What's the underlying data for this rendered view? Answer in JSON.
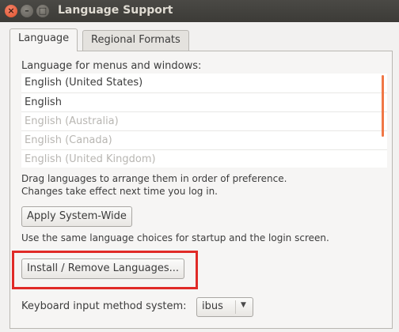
{
  "window": {
    "title": "Language Support",
    "close_glyph": "×",
    "min_glyph": "–",
    "max_glyph": "□"
  },
  "tabs": [
    {
      "label": "Language",
      "active": true
    },
    {
      "label": "Regional Formats",
      "active": false
    }
  ],
  "language": {
    "list_heading": "Language for menus and windows:",
    "items": [
      {
        "label": "English (United States)",
        "enabled": true
      },
      {
        "label": "English",
        "enabled": true
      },
      {
        "label": "English (Australia)",
        "enabled": false
      },
      {
        "label": "English (Canada)",
        "enabled": false
      },
      {
        "label": "English (United Kingdom)",
        "enabled": false
      }
    ],
    "help_line1": "Drag languages to arrange them in order of preference.",
    "help_line2": "Changes take effect next time you log in.",
    "apply_button": "Apply System-Wide",
    "apply_help": "Use the same language choices for startup and the login screen.",
    "install_button": "Install / Remove Languages...",
    "keyboard_label": "Keyboard input method system:",
    "keyboard_value": "ibus",
    "dropdown_glyph": "▼"
  },
  "colors": {
    "highlight": "#e02a27",
    "scroll_accent": "#f07746",
    "titlebar": "#3c3b37"
  }
}
